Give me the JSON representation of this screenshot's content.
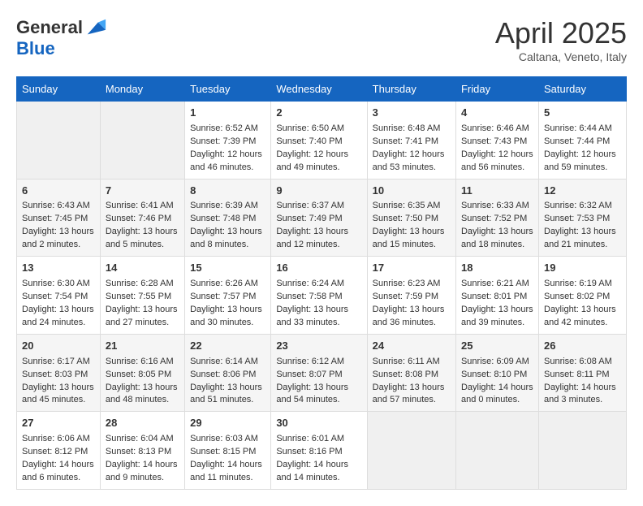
{
  "header": {
    "logo_line1": "General",
    "logo_line2": "Blue",
    "month": "April 2025",
    "location": "Caltana, Veneto, Italy"
  },
  "days_of_week": [
    "Sunday",
    "Monday",
    "Tuesday",
    "Wednesday",
    "Thursday",
    "Friday",
    "Saturday"
  ],
  "weeks": [
    [
      {
        "day": "",
        "empty": true
      },
      {
        "day": "",
        "empty": true
      },
      {
        "day": "1",
        "sunrise": "Sunrise: 6:52 AM",
        "sunset": "Sunset: 7:39 PM",
        "daylight": "Daylight: 12 hours and 46 minutes."
      },
      {
        "day": "2",
        "sunrise": "Sunrise: 6:50 AM",
        "sunset": "Sunset: 7:40 PM",
        "daylight": "Daylight: 12 hours and 49 minutes."
      },
      {
        "day": "3",
        "sunrise": "Sunrise: 6:48 AM",
        "sunset": "Sunset: 7:41 PM",
        "daylight": "Daylight: 12 hours and 53 minutes."
      },
      {
        "day": "4",
        "sunrise": "Sunrise: 6:46 AM",
        "sunset": "Sunset: 7:43 PM",
        "daylight": "Daylight: 12 hours and 56 minutes."
      },
      {
        "day": "5",
        "sunrise": "Sunrise: 6:44 AM",
        "sunset": "Sunset: 7:44 PM",
        "daylight": "Daylight: 12 hours and 59 minutes."
      }
    ],
    [
      {
        "day": "6",
        "sunrise": "Sunrise: 6:43 AM",
        "sunset": "Sunset: 7:45 PM",
        "daylight": "Daylight: 13 hours and 2 minutes."
      },
      {
        "day": "7",
        "sunrise": "Sunrise: 6:41 AM",
        "sunset": "Sunset: 7:46 PM",
        "daylight": "Daylight: 13 hours and 5 minutes."
      },
      {
        "day": "8",
        "sunrise": "Sunrise: 6:39 AM",
        "sunset": "Sunset: 7:48 PM",
        "daylight": "Daylight: 13 hours and 8 minutes."
      },
      {
        "day": "9",
        "sunrise": "Sunrise: 6:37 AM",
        "sunset": "Sunset: 7:49 PM",
        "daylight": "Daylight: 13 hours and 12 minutes."
      },
      {
        "day": "10",
        "sunrise": "Sunrise: 6:35 AM",
        "sunset": "Sunset: 7:50 PM",
        "daylight": "Daylight: 13 hours and 15 minutes."
      },
      {
        "day": "11",
        "sunrise": "Sunrise: 6:33 AM",
        "sunset": "Sunset: 7:52 PM",
        "daylight": "Daylight: 13 hours and 18 minutes."
      },
      {
        "day": "12",
        "sunrise": "Sunrise: 6:32 AM",
        "sunset": "Sunset: 7:53 PM",
        "daylight": "Daylight: 13 hours and 21 minutes."
      }
    ],
    [
      {
        "day": "13",
        "sunrise": "Sunrise: 6:30 AM",
        "sunset": "Sunset: 7:54 PM",
        "daylight": "Daylight: 13 hours and 24 minutes."
      },
      {
        "day": "14",
        "sunrise": "Sunrise: 6:28 AM",
        "sunset": "Sunset: 7:55 PM",
        "daylight": "Daylight: 13 hours and 27 minutes."
      },
      {
        "day": "15",
        "sunrise": "Sunrise: 6:26 AM",
        "sunset": "Sunset: 7:57 PM",
        "daylight": "Daylight: 13 hours and 30 minutes."
      },
      {
        "day": "16",
        "sunrise": "Sunrise: 6:24 AM",
        "sunset": "Sunset: 7:58 PM",
        "daylight": "Daylight: 13 hours and 33 minutes."
      },
      {
        "day": "17",
        "sunrise": "Sunrise: 6:23 AM",
        "sunset": "Sunset: 7:59 PM",
        "daylight": "Daylight: 13 hours and 36 minutes."
      },
      {
        "day": "18",
        "sunrise": "Sunrise: 6:21 AM",
        "sunset": "Sunset: 8:01 PM",
        "daylight": "Daylight: 13 hours and 39 minutes."
      },
      {
        "day": "19",
        "sunrise": "Sunrise: 6:19 AM",
        "sunset": "Sunset: 8:02 PM",
        "daylight": "Daylight: 13 hours and 42 minutes."
      }
    ],
    [
      {
        "day": "20",
        "sunrise": "Sunrise: 6:17 AM",
        "sunset": "Sunset: 8:03 PM",
        "daylight": "Daylight: 13 hours and 45 minutes."
      },
      {
        "day": "21",
        "sunrise": "Sunrise: 6:16 AM",
        "sunset": "Sunset: 8:05 PM",
        "daylight": "Daylight: 13 hours and 48 minutes."
      },
      {
        "day": "22",
        "sunrise": "Sunrise: 6:14 AM",
        "sunset": "Sunset: 8:06 PM",
        "daylight": "Daylight: 13 hours and 51 minutes."
      },
      {
        "day": "23",
        "sunrise": "Sunrise: 6:12 AM",
        "sunset": "Sunset: 8:07 PM",
        "daylight": "Daylight: 13 hours and 54 minutes."
      },
      {
        "day": "24",
        "sunrise": "Sunrise: 6:11 AM",
        "sunset": "Sunset: 8:08 PM",
        "daylight": "Daylight: 13 hours and 57 minutes."
      },
      {
        "day": "25",
        "sunrise": "Sunrise: 6:09 AM",
        "sunset": "Sunset: 8:10 PM",
        "daylight": "Daylight: 14 hours and 0 minutes."
      },
      {
        "day": "26",
        "sunrise": "Sunrise: 6:08 AM",
        "sunset": "Sunset: 8:11 PM",
        "daylight": "Daylight: 14 hours and 3 minutes."
      }
    ],
    [
      {
        "day": "27",
        "sunrise": "Sunrise: 6:06 AM",
        "sunset": "Sunset: 8:12 PM",
        "daylight": "Daylight: 14 hours and 6 minutes."
      },
      {
        "day": "28",
        "sunrise": "Sunrise: 6:04 AM",
        "sunset": "Sunset: 8:13 PM",
        "daylight": "Daylight: 14 hours and 9 minutes."
      },
      {
        "day": "29",
        "sunrise": "Sunrise: 6:03 AM",
        "sunset": "Sunset: 8:15 PM",
        "daylight": "Daylight: 14 hours and 11 minutes."
      },
      {
        "day": "30",
        "sunrise": "Sunrise: 6:01 AM",
        "sunset": "Sunset: 8:16 PM",
        "daylight": "Daylight: 14 hours and 14 minutes."
      },
      {
        "day": "",
        "empty": true
      },
      {
        "day": "",
        "empty": true
      },
      {
        "day": "",
        "empty": true
      }
    ]
  ]
}
